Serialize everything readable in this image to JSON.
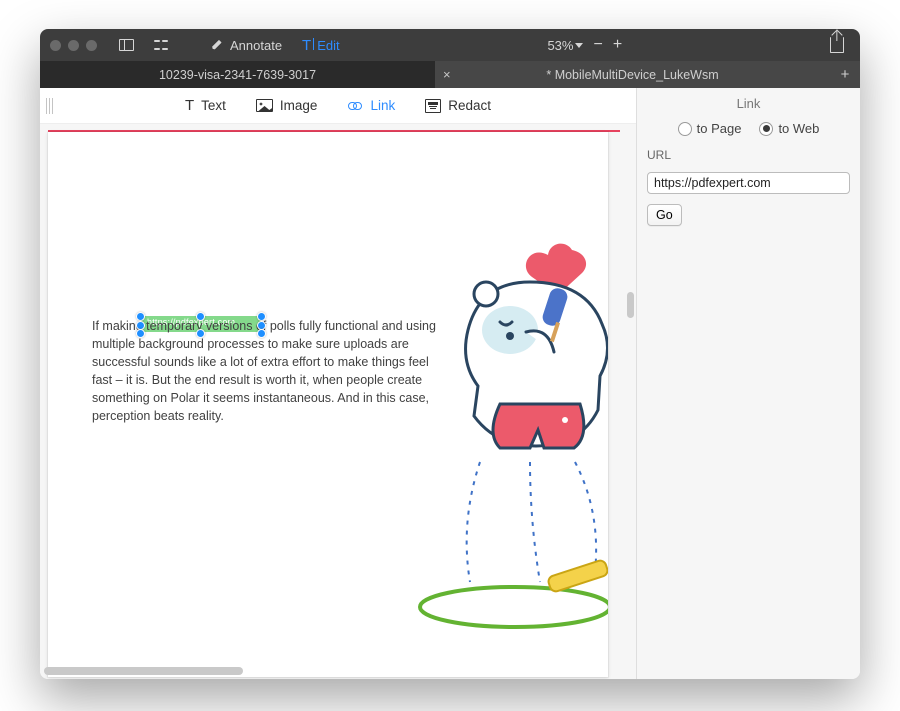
{
  "titlebar": {
    "annotate": "Annotate",
    "edit": "Edit",
    "zoom": "53%"
  },
  "tabs": {
    "items": [
      {
        "label": "10239-visa-2341-7639-3017",
        "active": false
      },
      {
        "label": "* MobileMultiDevice_LukeWsm",
        "active": true
      }
    ]
  },
  "tools": {
    "text": "Text",
    "image": "Image",
    "link": "Link",
    "redact": "Redact"
  },
  "inspector": {
    "title": "Link",
    "to_page": "to Page",
    "to_web": "to Web",
    "url_label": "URL",
    "url_value": "https://pdfexpert.com",
    "go": "Go"
  },
  "page": {
    "paragraph": "If making temporary versions of polls fully functional and using multiple background processes to make sure uploads are successful sounds like a lot of extra effort to make things feel fast – it is. But the end result is worth it, when people create something on Polar it seems instantaneous. And in this case, perception beats reality.",
    "selected_text_label": "https://pdfexpert.com"
  }
}
